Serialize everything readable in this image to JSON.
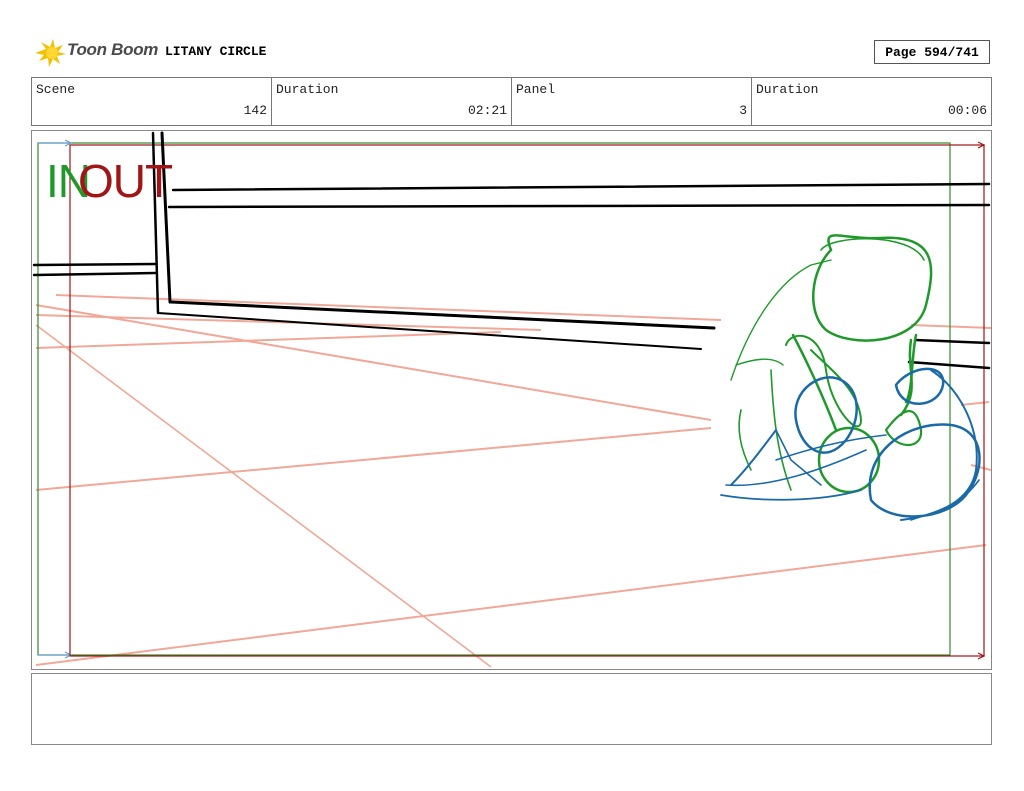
{
  "header": {
    "logo_text": "Toon Boom",
    "project_title": "LITANY CIRCLE",
    "page_label": "Page 594/741"
  },
  "info": {
    "scene_label": "Scene",
    "scene_value": "142",
    "scene_duration_label": "Duration",
    "scene_duration_value": "02:21",
    "panel_label": "Panel",
    "panel_value": "3",
    "panel_duration_label": "Duration",
    "panel_duration_value": "00:06"
  },
  "panel": {
    "in_label": "IN",
    "out_label": "OUT",
    "colors": {
      "in_frame": "#2e8b2e",
      "out_frame": "#a01515",
      "perspective_lines": "#f0a898",
      "ink": "#000000",
      "green_sketch": "#1f9a2a",
      "blue_sketch": "#1a6aa8"
    }
  },
  "notes": {
    "text": ""
  }
}
